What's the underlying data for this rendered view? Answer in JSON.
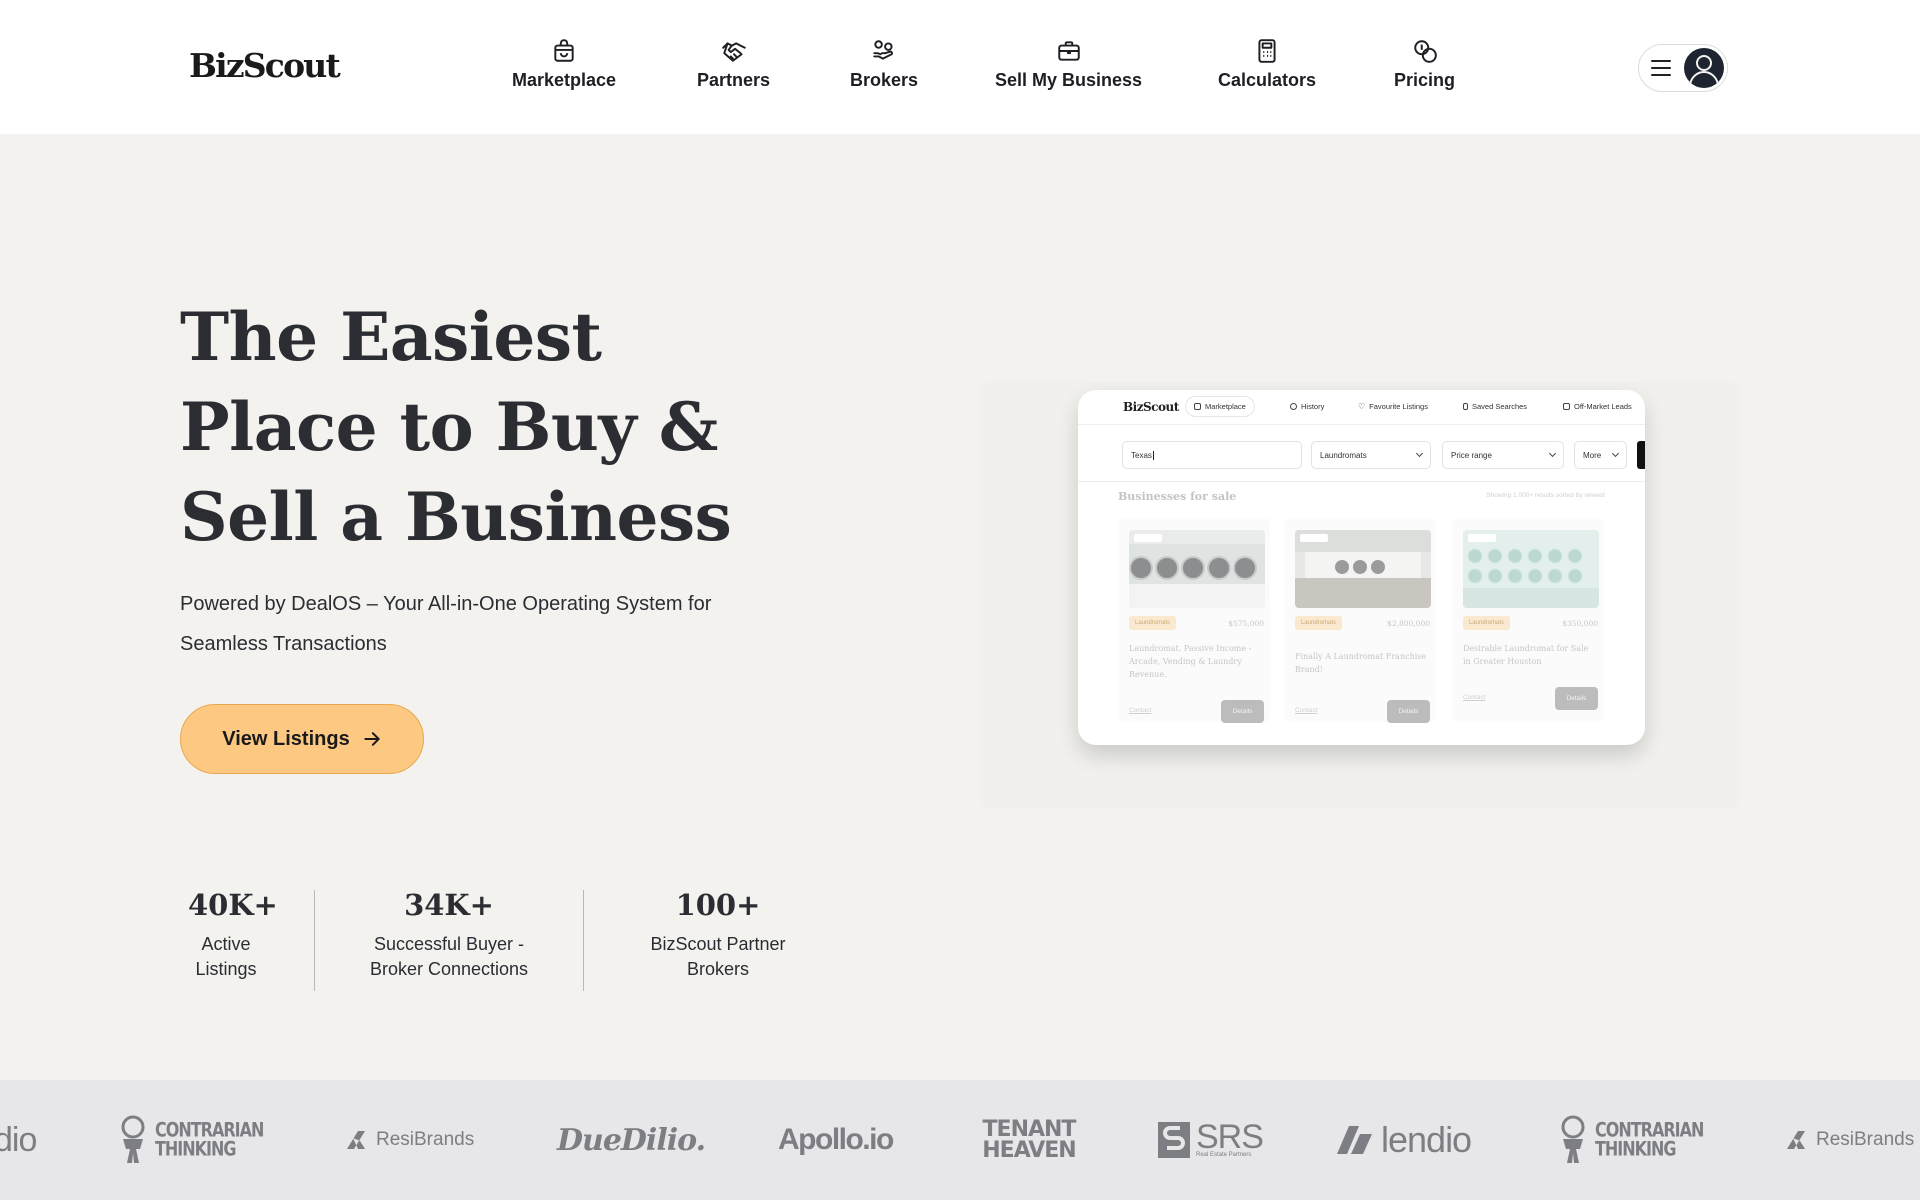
{
  "header": {
    "logo": "BizScout",
    "nav": [
      {
        "label": "Marketplace",
        "icon": "shopping-bag-icon"
      },
      {
        "label": "Partners",
        "icon": "handshake-icon"
      },
      {
        "label": "Brokers",
        "icon": "hand-coins-icon"
      },
      {
        "label": "Sell My Business",
        "icon": "briefcase-icon"
      },
      {
        "label": "Calculators",
        "icon": "calculator-icon"
      },
      {
        "label": "Pricing",
        "icon": "coins-icon"
      }
    ],
    "user_menu": {
      "icons": [
        "hamburger-icon",
        "user-avatar-icon"
      ]
    }
  },
  "hero": {
    "title": "The Easiest Place to Buy & Sell a Business",
    "subtitle": "Powered by DealOS – Your All-in-One Operating System for Seamless Transactions",
    "cta_label": "View Listings",
    "cta_icon": "arrow-right-icon",
    "cta_color": "#fdc982"
  },
  "stats": [
    {
      "value": "40K+",
      "label": "Active Listings"
    },
    {
      "value": "34K+",
      "label": "Successful Buyer - Broker Connections"
    },
    {
      "value": "100+",
      "label": "BizScout Partner Brokers"
    }
  ],
  "mockup": {
    "logo": "BizScout",
    "nav": [
      {
        "label": "Marketplace",
        "active": true
      },
      {
        "label": "History"
      },
      {
        "label": "Favourite Listings"
      },
      {
        "label": "Saved Searches"
      },
      {
        "label": "Off-Market Leads"
      }
    ],
    "search_value": "Texas",
    "category": "Laundromats",
    "price_placeholder": "Price range",
    "more_label": "More",
    "heading": "Businesses for sale",
    "results": "Showing 1,000+ results  sorted by newest",
    "cards": [
      {
        "tag": "Laundromats",
        "price": "$575,000",
        "title": "Laundromat. Passive Income - Arcade, Vending & Laundry Revenue.",
        "contact": "Contact",
        "details": "Details"
      },
      {
        "tag": "Laundromats",
        "price": "$2,800,000",
        "title": "Finally A Laundromat Franchise Brand!",
        "contact": "Contact",
        "details": "Details"
      },
      {
        "tag": "Laundromats",
        "price": "$350,000",
        "title": "Desirable Laundromat for Sale in Greater Houston",
        "contact": "Contact",
        "details": "Details"
      }
    ]
  },
  "partner_logos": [
    {
      "name": "dio"
    },
    {
      "name": "CONTRARIAN THINKING"
    },
    {
      "name": "ResiBrands"
    },
    {
      "name": "DueDilio."
    },
    {
      "name": "Apollo.io"
    },
    {
      "name": "TENANT HEAVEN"
    },
    {
      "name": "SRS",
      "sub": "Real Estate Partners"
    },
    {
      "name": "lendio"
    },
    {
      "name": "CONTRARIAN THINKING"
    },
    {
      "name": "ResiBrands"
    }
  ]
}
